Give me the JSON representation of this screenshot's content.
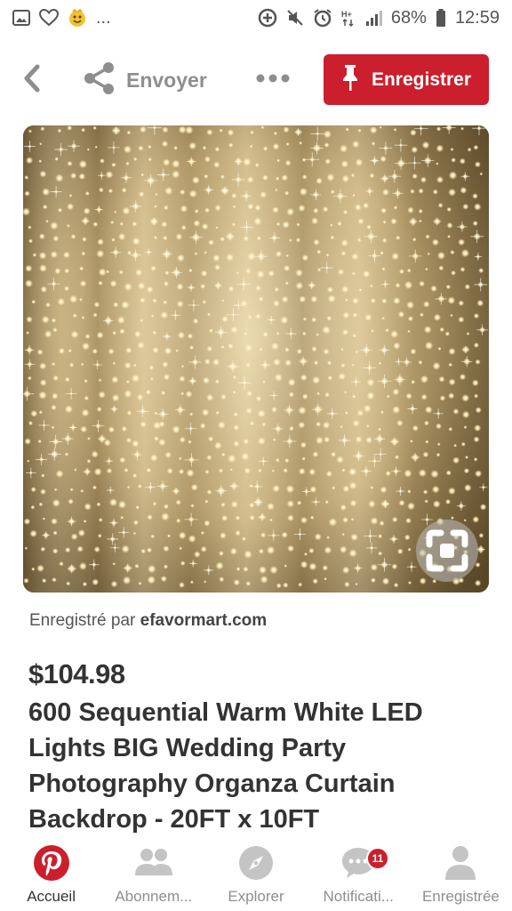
{
  "status_bar": {
    "left_icons": [
      "gallery-icon",
      "heart-outline-icon",
      "emoji-icon"
    ],
    "left_more": "...",
    "right_icons": [
      "data-saver-icon",
      "mute-icon",
      "alarm-icon",
      "hplus-signal-icon",
      "signal-icon"
    ],
    "battery_percent": "68%",
    "time": "12:59"
  },
  "action_bar": {
    "back_icon": "chevron-left-icon",
    "share_label": "Envoyer",
    "more_icon": "ellipsis-icon",
    "save_label": "Enregistrer",
    "accent_color": "#cb1f2d"
  },
  "pin": {
    "image_subject": "Warm white LED curtain lights on organza backdrop",
    "lens_icon": "visual-search-icon",
    "saved_by_prefix": "Enregistré par",
    "saved_by_site": "efavormart.com",
    "price": "$104.98",
    "title": "600 Sequential Warm White LED Lights BIG Wedding Party Photography Organza Curtain Backdrop - 20FT x 10FT"
  },
  "bottom_nav": {
    "items": [
      {
        "label": "Accueil",
        "icon": "pinterest-logo-icon",
        "active": true
      },
      {
        "label": "Abonnem...",
        "icon": "people-icon",
        "active": false
      },
      {
        "label": "Explorer",
        "icon": "compass-icon",
        "active": false
      },
      {
        "label": "Notificati...",
        "icon": "chat-bubble-icon",
        "active": false,
        "badge": "11"
      },
      {
        "label": "Enregistrée",
        "icon": "person-icon",
        "active": false
      }
    ]
  }
}
